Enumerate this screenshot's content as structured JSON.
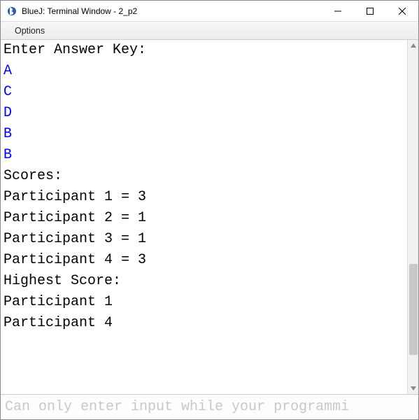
{
  "window": {
    "title": "BlueJ: Terminal Window - 2_p2"
  },
  "menubar": {
    "options": "Options"
  },
  "terminal": {
    "prompt_enter_key": "Enter Answer Key:",
    "answers": [
      "A",
      "C",
      "D",
      "B",
      "B"
    ],
    "scores_header": "Scores:",
    "scores": [
      "Participant 1 = 3",
      "Participant 2 = 1",
      "Participant 3 = 1",
      "Participant 4 = 3"
    ],
    "highest_header": "Highest Score:",
    "highest": [
      "Participant 1",
      "Participant 4"
    ]
  },
  "input_bar": {
    "placeholder": "Can only enter input while your programmi"
  }
}
